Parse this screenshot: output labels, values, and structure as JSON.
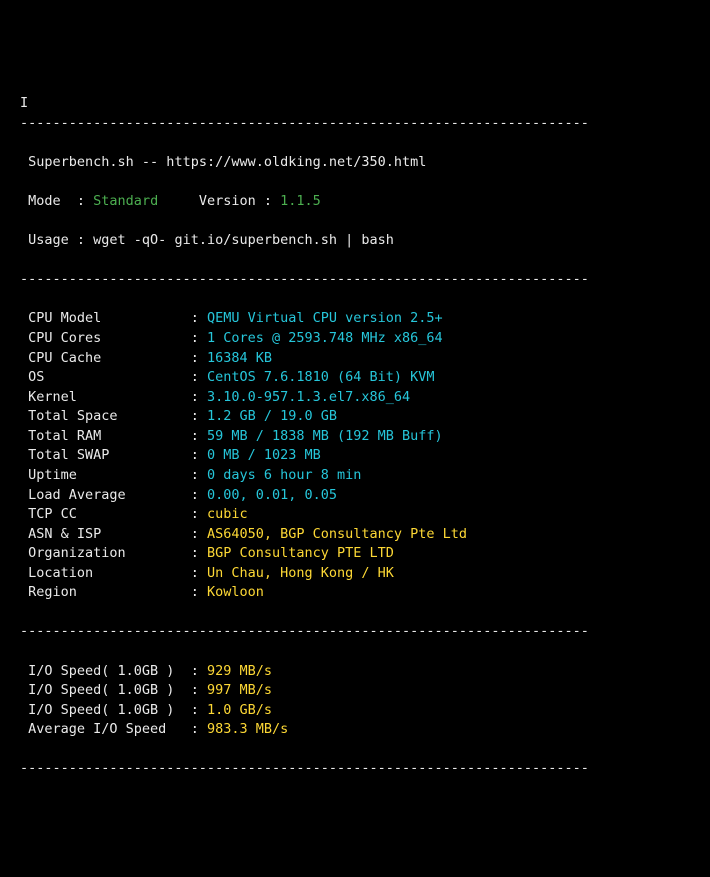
{
  "header": {
    "title_line": "Superbench.sh -- https://www.oldking.net/350.html",
    "mode_label": "Mode  ",
    "mode_value": "Standard",
    "version_label": "Version ",
    "version_value": "1.1.5",
    "usage_line": "Usage : wget -qO- git.io/superbench.sh | bash"
  },
  "dashes": "----------------------------------------------------------------------",
  "info": [
    {
      "label": "CPU Model",
      "colon": ":",
      "value": "QEMU Virtual CPU version 2.5+",
      "color": "cyan"
    },
    {
      "label": "CPU Cores",
      "colon": ":",
      "value": "1 Cores @ 2593.748 MHz x86_64",
      "color": "cyan"
    },
    {
      "label": "CPU Cache",
      "colon": ":",
      "value": "16384 KB",
      "color": "cyan"
    },
    {
      "label": "OS",
      "colon": ":",
      "value": "CentOS 7.6.1810 (64 Bit) KVM",
      "color": "cyan"
    },
    {
      "label": "Kernel",
      "colon": ":",
      "value": "3.10.0-957.1.3.el7.x86_64",
      "color": "cyan"
    },
    {
      "label": "Total Space",
      "colon": ":",
      "value": "1.2 GB / 19.0 GB",
      "color": "cyan"
    },
    {
      "label": "Total RAM",
      "colon": ":",
      "value": "59 MB / 1838 MB (192 MB Buff)",
      "color": "cyan"
    },
    {
      "label": "Total SWAP",
      "colon": ":",
      "value": "0 MB / 1023 MB",
      "color": "cyan"
    },
    {
      "label": "Uptime",
      "colon": ":",
      "value": "0 days 6 hour 8 min",
      "color": "cyan"
    },
    {
      "label": "Load Average",
      "colon": ":",
      "value": "0.00, 0.01, 0.05",
      "color": "cyan"
    },
    {
      "label": "TCP CC",
      "colon": ":",
      "value": "cubic",
      "color": "yellow"
    },
    {
      "label": "ASN & ISP",
      "colon": ":",
      "value": "AS64050, BGP Consultancy Pte Ltd",
      "color": "yellow"
    },
    {
      "label": "Organization",
      "colon": ":",
      "value": "BGP Consultancy PTE LTD",
      "color": "yellow"
    },
    {
      "label": "Location",
      "colon": ":",
      "value": "Un Chau, Hong Kong / HK",
      "color": "yellow"
    },
    {
      "label": "Region",
      "colon": ":",
      "value": "Kowloon",
      "color": "yellow"
    }
  ],
  "io": [
    {
      "label": "I/O Speed( 1.0GB )",
      "colon": ":",
      "value": "929 MB/s",
      "color": "yellow"
    },
    {
      "label": "I/O Speed( 1.0GB )",
      "colon": ":",
      "value": "997 MB/s",
      "color": "yellow"
    },
    {
      "label": "I/O Speed( 1.0GB )",
      "colon": ":",
      "value": "1.0 GB/s",
      "color": "yellow"
    },
    {
      "label": "Average I/O Speed",
      "colon": ":",
      "value": "983.3 MB/s",
      "color": "yellow"
    }
  ]
}
